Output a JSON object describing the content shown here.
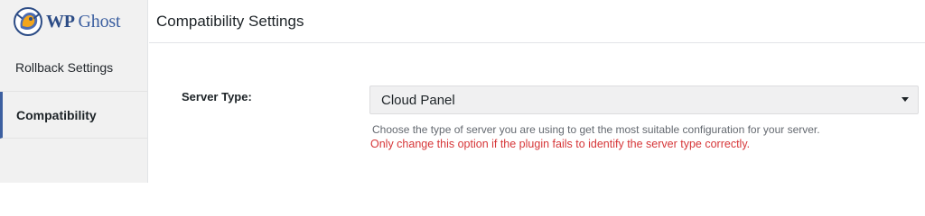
{
  "brand": {
    "name_part1": "WP",
    "name_part2": "Ghost",
    "logo_icon": "wp-ghost-logo-icon"
  },
  "sidebar": {
    "items": [
      {
        "label": "Rollback Settings",
        "active": false
      },
      {
        "label": "Compatibility",
        "active": true
      }
    ]
  },
  "header": {
    "title": "Compatibility Settings"
  },
  "form": {
    "server_type": {
      "label": "Server Type:",
      "selected": "Cloud Panel",
      "caret_icon": "caret-down-icon",
      "help": "Choose the type of server you are using to get the most suitable configuration for your server.",
      "warning": "Only change this option if the plugin fails to identify the server type correctly."
    }
  },
  "colors": {
    "brand": "#3c5fa0",
    "warning": "#d63638",
    "sidebar_bg": "#f1f1f1"
  }
}
